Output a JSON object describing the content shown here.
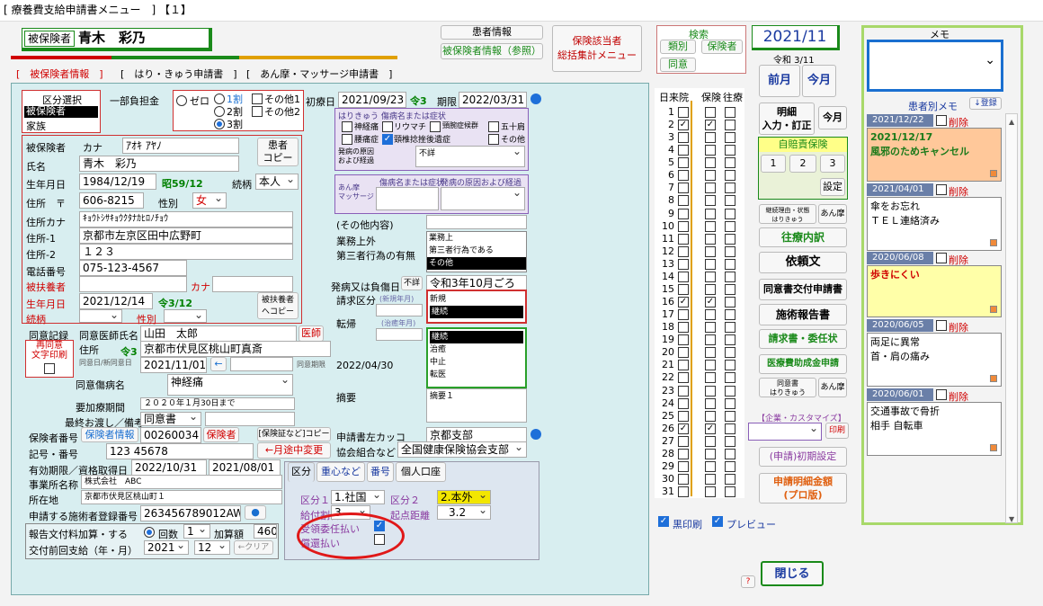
{
  "window_title": "[ 療養費支給申請書メニュー　] 【１】",
  "header": {
    "patient_label": "被保険者",
    "patient_name": "青木　彩乃",
    "info_btn": "患者情報",
    "info_ref_btn": "被保険者情報（参照）",
    "summary_btn": "保険該当者\n総括集計メニュー"
  },
  "tabs": [
    "[　被保険者情報　]",
    "[　はり・きゅう申請書　]",
    "[　あん摩・マッサージ申請書　]"
  ],
  "left": {
    "kubun_title": "区分選択",
    "kubun_items": [
      "被保険者",
      "家族"
    ],
    "futan_label": "一部負担金",
    "futan_opts": [
      "ゼロ",
      "1割",
      "2割",
      "3割"
    ],
    "other1": "その他1",
    "other2": "その他2",
    "kana_label": "カナ",
    "kana_value": "ｱｵｷ ｱﾔﾉ",
    "hihoken_label": "被保険者",
    "name_label": "氏名",
    "name_value": "青木　彩乃",
    "copy_btn": "患者\nコピー",
    "birth_label": "生年月日",
    "birth_value": "1984/12/19",
    "age": "昭59/12",
    "zoku_label": "続柄",
    "zoku_value": "本人",
    "addr_label": "住所　〒",
    "zip": "606-8215",
    "sex_label": "性別",
    "sex_value": "女",
    "addrkana_label": "住所カナ",
    "addrkana_value": "ｷｮｳﾄｼｻｷｮｳｸﾀﾅｶﾋﾛﾉﾁｮｳ",
    "addr1_label": "住所-1",
    "addr1_value": "京都市左京区田中広野町",
    "addr2_label": "住所-2",
    "addr2_value": "１２３",
    "tel_label": "電話番号",
    "tel_value": "075-123-4567",
    "fuyo_label": "被扶養者",
    "fuyo_kana": "カナ",
    "fuyo_birth_label": "生年月日",
    "fuyo_birth_value": "2021/12/14",
    "fuyo_age": "令3/12",
    "fuyo_zoku": "続柄",
    "fuyo_sex": "性別",
    "fuyo_copy": "被扶養者\nへコピー"
  },
  "shoshin": {
    "label": "初療日",
    "value": "2021/09/23",
    "era": "令3",
    "kigen_label": "期限",
    "kigen_value": "2022/03/31"
  },
  "harikyu": {
    "title": "はりきゅう 傷病名または症状",
    "items": [
      "神経痛",
      "リウマチ",
      "頸腕症候群",
      "五十肩",
      "腰痛症",
      "頸椎捻挫後遺症",
      "その他"
    ],
    "cause_label": "発病の原因\nおよび経過",
    "cause_value": "不詳"
  },
  "anma": {
    "title": "あん摩\nマッサージ",
    "col1": "傷病名または症状",
    "col2": "発病の原因および経過"
  },
  "sonota": {
    "title": "(その他内容)",
    "gyomu": "業務上外",
    "daisan": "第三者行為の有無",
    "list": [
      "業務上",
      "第三者行為である",
      "その他"
    ],
    "hatsubyo_label": "発病又は負傷日",
    "fusho_btn": "不詳",
    "hatsubyo_value": "令和3年10月ごろ",
    "seikyu_label": "請求区分",
    "seikyu_sub": "(新規年月)",
    "seikyu_list": [
      "新規",
      "継続"
    ],
    "tenki_label": "転帰",
    "tenki_sub": "(治癒年月)",
    "tenki_list": [
      "継続",
      "治癒",
      "中止",
      "転医"
    ],
    "tekiyo_label": "摘要",
    "tekiyo_value": "摘要１"
  },
  "doctor": {
    "doui_label": "同意記録",
    "doui_name_label": "同意医師氏名",
    "doui_name": "山田　太郎",
    "ishi_btn": "医師",
    "saido_label": "再同意\n文字印刷",
    "addr_label": "住所",
    "addr_era": "令3",
    "addr_value": "京都市伏見区桃山町真斎",
    "date_label": "同意日/新同意日",
    "date_value": "2021/11/01",
    "kigen_label": "同意期限",
    "kigen_value": "2022/04/30",
    "byomei_label": "同意傷病名",
    "byomei_value": "神経痛",
    "yoka_label": "要加療期間",
    "yoka_value": "２０２０年１月30日まで",
    "saishu_label": "最終お渡し／備考",
    "saishu_value": "同意書"
  },
  "insurer": {
    "no_label": "保険者番号",
    "info_btn": "保険者情報",
    "no_value": "00260034",
    "hokensha_btn": "保険者",
    "copy_btn": "[保険証など]コピー",
    "kakko_label": "申請書左カッコ",
    "kakko_value": "京都支部",
    "kigo_label": "記号・番号",
    "kigo_value": "123 45678",
    "midchange_btn": "←月途中変更",
    "kyokai_label": "協会組合など",
    "kyokai_value": "全国健康保険協会支部",
    "yuko_label": "有効期限／資格取得日",
    "yuko_value": "2022/10/31",
    "shutoku_value": "2021/08/01",
    "jigyo_label": "事業所名称",
    "jigyo_value": "株式会社　ABC",
    "shozai_label": "所在地",
    "shozai_value": "京都市伏見区桃山町１",
    "shinsei_label": "申請する施術者登録番号",
    "shinsei_value": "263456789012AW",
    "hokoku_label": "報告文付料加算・する",
    "kaisu_label": "回数",
    "kaisu_value": "1",
    "kasan_label": "加算額",
    "kasan_value": "460",
    "zenkai_label": "交付前回支給（年・月）",
    "zenkai_year": "2021",
    "zenkai_month": "12",
    "clear_btn": "←クリア"
  },
  "subtabs": [
    "区分",
    "重心など",
    "番号",
    "個人口座"
  ],
  "kubun": {
    "k1_label": "区分１",
    "k1_value": "1.社国",
    "k2_label": "区分２",
    "k2_value": "2.本外",
    "kyufu_label": "給付割合",
    "kyufu_value": "3",
    "kiten_label": "起点距離",
    "kiten_value": "3.2",
    "juryo_label": "受領委任払い",
    "shoukan_label": "償還払い"
  },
  "search": {
    "title": "検索",
    "rui": "類別",
    "hokensha": "保険者",
    "doui": "同意"
  },
  "date": {
    "year_month": "2021/11",
    "era": "令和 3/11",
    "prev": "前月",
    "cur": "今月",
    "meisai": "明細\n入力・訂正",
    "kongetsu": "今月"
  },
  "days": {
    "header": [
      "日",
      "来院",
      "保険",
      "往療"
    ],
    "checked_raiin": [
      2,
      16,
      26
    ],
    "checked_hoken": [
      2,
      16,
      26
    ]
  },
  "jiba": {
    "title": "自賠責保険",
    "b1": "1",
    "b2": "2",
    "b3": "3",
    "setting": "設定"
  },
  "actions": {
    "keizoku": "継続理由・状態\nはりきゅう",
    "anma1": "あん摩",
    "ouryo": "往療内訳",
    "irai": "依頼文",
    "doui": "同意書交付申請書",
    "sejutsu": "施術報告書",
    "seikyu": "請求書・委任状",
    "iryohi": "医療費助成金申請",
    "doui2": "同意書\nはりきゅう",
    "anma2": "あん摩",
    "custom": "【企業・カスタマイズ】",
    "print": "印刷",
    "initial": "(申請)初期設定",
    "meisai_total": "申請明細金額\n(プロ版)"
  },
  "bottom": {
    "kuro": "黒印刷",
    "preview": "プレビュー",
    "close": "閉じる",
    "help": "?"
  },
  "memo": {
    "title": "メモ",
    "patient_memo": "患者別メモ",
    "register": "↓登録",
    "entries": [
      {
        "date": "2021/12/22",
        "del": "削除",
        "text": "2021/12/17\n風邪のためキャンセル",
        "bg": "#ffc89a"
      },
      {
        "date": "2021/04/01",
        "del": "削除",
        "text": "傘をお忘れ\nＴＥＬ連絡済み",
        "bg": "#ffffff"
      },
      {
        "date": "2020/06/08",
        "del": "削除",
        "text": "歩きにくい",
        "bg": "#ffffa8"
      },
      {
        "date": "2020/06/05",
        "del": "削除",
        "text": "両足に異常\n首・肩の痛み",
        "bg": "#ffffff"
      },
      {
        "date": "2020/06/01",
        "del": "削除",
        "text": "交通事故で骨折\n相手 自転車",
        "bg": "#ffffff"
      }
    ]
  }
}
